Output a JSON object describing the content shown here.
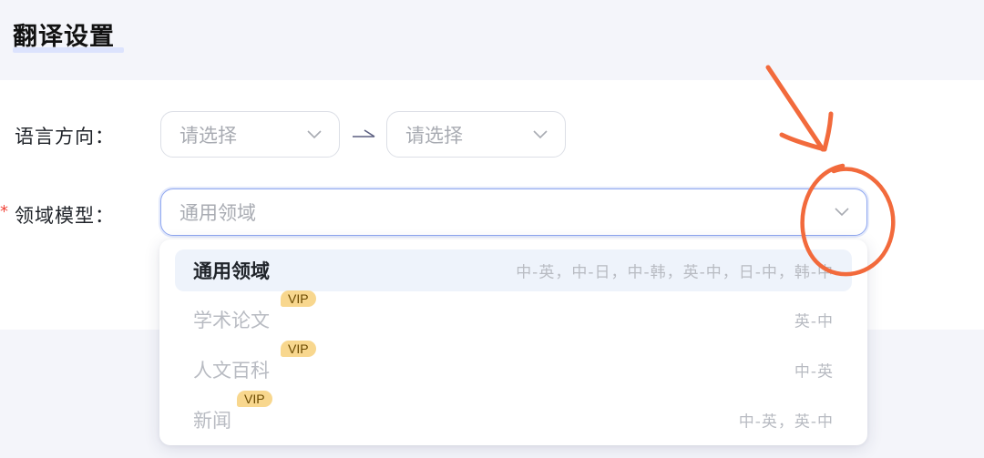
{
  "header": {
    "title": "翻译设置"
  },
  "form": {
    "language_direction": {
      "label": "语言方向：",
      "source_placeholder": "请选择",
      "target_placeholder": "请选择"
    },
    "domain_model": {
      "required_mark": "*",
      "label": "领域模型：",
      "value": "通用领域"
    }
  },
  "dropdown": {
    "options": [
      {
        "name": "通用领域",
        "languages": "中-英，中-日，中-韩，英-中，日-中，韩-中",
        "vip": "",
        "selected": true
      },
      {
        "name": "学术论文",
        "languages": "英-中",
        "vip": "VIP",
        "selected": false
      },
      {
        "name": "人文百科",
        "languages": "中-英",
        "vip": "VIP",
        "selected": false
      },
      {
        "name": "新闻",
        "languages": "中-英，英-中",
        "vip": "VIP",
        "selected": false
      }
    ]
  },
  "colors": {
    "accent_border": "#8fa7f0",
    "annotation": "#f26a3c",
    "vip_badge": "#f8d78e"
  }
}
